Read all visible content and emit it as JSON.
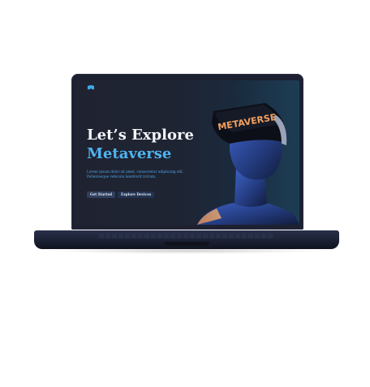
{
  "hero": {
    "headline_line1": "Let’s Explore",
    "headline_line2": "Metaverse",
    "description": "Lorem ipsum dolor sit amet, consectetur adipiscing elit. Pellentesque vehicula hendrerit rutrum.",
    "headset_label": "METAVERSE"
  },
  "buttons": {
    "get_started": "Get Started",
    "explore_devices": "Explore Devices"
  },
  "colors": {
    "accent": "#4fb3f0",
    "screen_bg": "#1f2331",
    "headset_text": "#f0a060",
    "figure": "#2a4a9a"
  },
  "icons": {
    "logo": "vr-headset-logo-icon"
  }
}
